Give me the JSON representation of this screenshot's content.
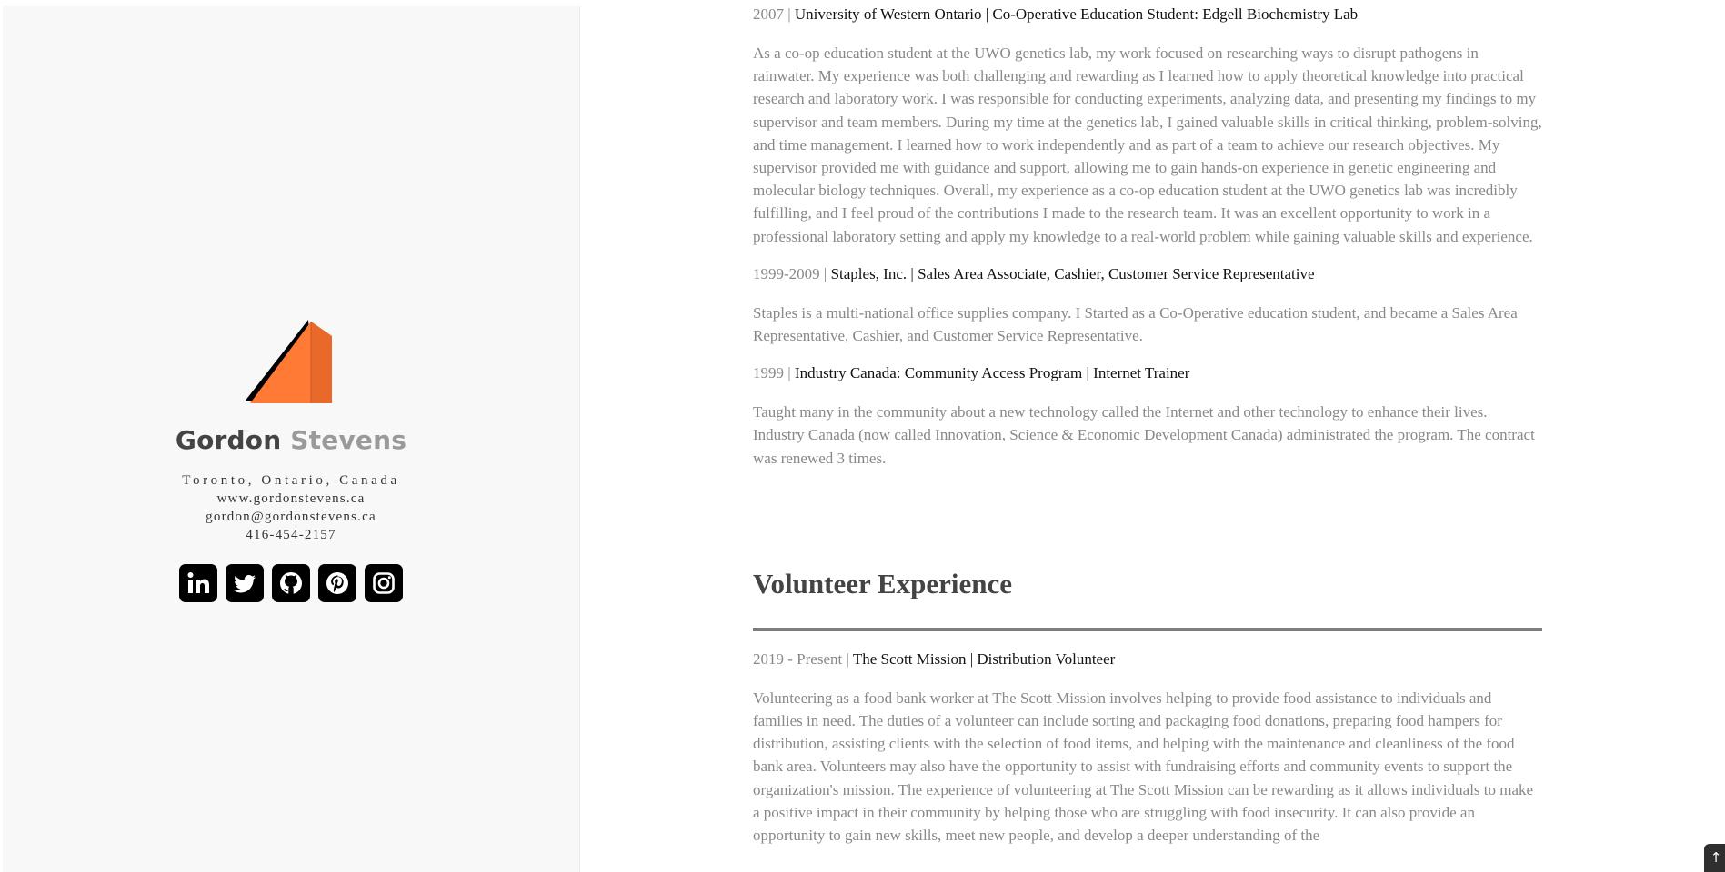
{
  "profile": {
    "first_name": "Gordon",
    "last_name": "Stevens",
    "location": "Toronto, Ontario, Canada",
    "website": "www.gordonstevens.ca",
    "email": "gordon@gordonstevens.ca",
    "phone": "416-454-2157",
    "logo_color": "#ff7a35",
    "socials": [
      {
        "name": "LinkedIn",
        "icon": "linkedin-icon"
      },
      {
        "name": "Twitter",
        "icon": "twitter-icon"
      },
      {
        "name": "GitHub",
        "icon": "github-icon"
      },
      {
        "name": "Pinterest",
        "icon": "pinterest-icon"
      },
      {
        "name": "Instagram",
        "icon": "instagram-icon"
      }
    ]
  },
  "work": [
    {
      "date": "2007",
      "sep1": " | ",
      "org": "University of Western Ontario",
      "sep2": " | ",
      "role": "Co-Operative Education Student: Edgell Biochemistry Lab",
      "body": "As a co-op education student at the UWO genetics lab, my work focused on researching ways to disrupt pathogens in rainwater. My experience was both challenging and rewarding as I learned how to apply theoretical knowledge into practical research and laboratory work. I was responsible for conducting experiments, analyzing data, and presenting my findings to my supervisor and team members. During my time at the genetics lab, I gained valuable skills in critical thinking, problem-solving, and time management. I learned how to work independently and as part of a team to achieve our research objectives. My supervisor provided me with guidance and support, allowing me to gain hands-on experience in genetic engineering and molecular biology techniques. Overall, my experience as a co-op education student at the UWO genetics lab was incredibly fulfilling, and I feel proud of the contributions I made to the research team. It was an excellent opportunity to work in a professional laboratory setting and apply my knowledge to a real-world problem while gaining valuable skills and experience."
    },
    {
      "date": "1999-2009",
      "sep1": " | ",
      "org": "Staples, Inc.",
      "sep2": " | ",
      "role": "Sales Area Associate, Cashier, Customer Service Representative",
      "body": "Staples is a multi-national office supplies company. I Started as a Co-Operative education student, and became a Sales Area Representative, Cashier, and Customer Service Representative."
    },
    {
      "date": "1999",
      "sep1": " | ",
      "org": "Industry Canada: Community Access Program",
      "sep2": " | ",
      "role": "Internet Trainer",
      "body": "Taught many in the community about a new technology called the Internet and other technology to enhance their lives. Industry Canada (now called Innovation, Science & Economic Development Canada) administrated the program. The contract was renewed 3 times."
    }
  ],
  "volunteer": {
    "title": "Volunteer Experience",
    "entries": [
      {
        "date": "2019 - Present",
        "sep1": " | ",
        "org": "The Scott Mission",
        "sep2": " | ",
        "role": "Distribution Volunteer",
        "body": "Volunteering as a food bank worker at The Scott Mission involves helping to provide food assistance to individuals and families in need. The duties of a volunteer can include sorting and packaging food donations, preparing food hampers for distribution, assisting clients with the selection of food items, and helping with the maintenance and cleanliness of the food bank area. Volunteers may also have the opportunity to assist with fundraising efforts and community events to support the organization's mission. The experience of volunteering at The Scott Mission can be rewarding as it allows individuals to make a positive impact in their community by helping those who are struggling with food insecurity. It can also provide an opportunity to gain new skills, meet new people, and develop a deeper understanding of the"
      }
    ]
  },
  "scroll_top_label": "↑"
}
